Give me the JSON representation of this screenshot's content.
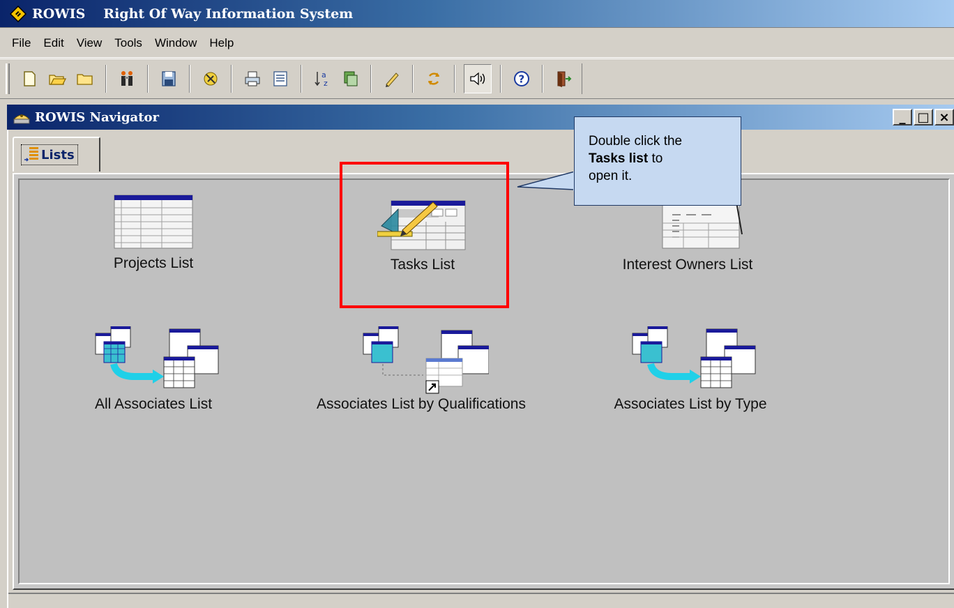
{
  "app": {
    "short_name": "ROWIS",
    "full_name": "Right Of Way Information System"
  },
  "menu": [
    "File",
    "Edit",
    "View",
    "Tools",
    "Window",
    "Help"
  ],
  "toolbar": {
    "buttons": [
      "new-document-icon",
      "open-folder-icon",
      "folder-icon",
      "find-people-icon",
      "save-icon",
      "tasks-icon",
      "print-icon",
      "preview-icon",
      "sort-az-icon",
      "filter-icon",
      "edit-pen-icon",
      "refresh-icon",
      "sound-icon",
      "help-icon",
      "exit-door-icon"
    ],
    "pressed": "sound-icon"
  },
  "navigator": {
    "title": "ROWIS Navigator",
    "controls": [
      "_",
      "□",
      "×"
    ],
    "tab_label": "Lists",
    "items": [
      {
        "label": "Projects List",
        "icon": "projects-list-icon"
      },
      {
        "label": "Tasks List",
        "icon": "tasks-list-icon"
      },
      {
        "label": "Interest Owners List",
        "icon": "interest-owners-list-icon"
      },
      {
        "label": "All Associates List",
        "icon": "all-associates-list-icon"
      },
      {
        "label": "Associates List by Qualifications",
        "icon": "associates-qualifications-icon"
      },
      {
        "label": "Associates List by Type",
        "icon": "associates-type-icon"
      }
    ]
  },
  "callout": {
    "line1": "Double click the",
    "bold": "Tasks list",
    "line2_rest": " to",
    "line3": "open it."
  },
  "colors": {
    "title_gradient_start": "#0a246a",
    "title_gradient_end": "#a6caf0",
    "highlight": "#ff0000",
    "callout_fill": "#c6d9f1"
  }
}
